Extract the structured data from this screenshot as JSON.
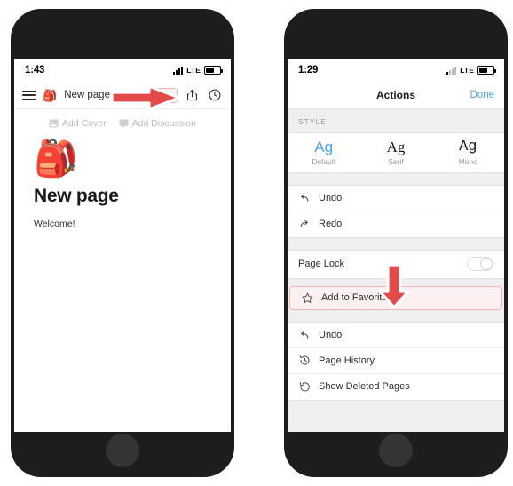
{
  "left_phone": {
    "status_bar": {
      "time": "1:43",
      "network_label": "LTE",
      "signal_icon": "signal-bars-icon",
      "battery_icon": "battery-icon"
    },
    "toolbar": {
      "menu_icon": "hamburger-menu-icon",
      "page_emoji": "🎒",
      "page_name": "New page",
      "more_icon": "ellipsis-icon",
      "share_icon": "share-icon",
      "history_icon": "clock-icon"
    },
    "page": {
      "add_cover_label": "Add Cover",
      "add_cover_icon": "image-icon",
      "add_discussion_label": "Add Discussion",
      "add_discussion_icon": "comment-icon",
      "hero_emoji": "🎒",
      "title": "New page",
      "body_text": "Welcome!"
    },
    "annotation": {
      "arrow_direction": "right",
      "arrow_color": "#e34b4b",
      "points_to": "ellipsis-icon"
    }
  },
  "right_phone": {
    "status_bar": {
      "time": "1:29",
      "network_label": "LTE",
      "signal_icon": "signal-bars-icon",
      "battery_icon": "battery-icon"
    },
    "sheet": {
      "title": "Actions",
      "done_label": "Done",
      "done_color": "#4aa3df",
      "style_group_label": "STYLE",
      "style_options": [
        {
          "sample": "Ag",
          "name": "Default",
          "selected": true
        },
        {
          "sample": "Ag",
          "name": "Serif",
          "selected": false
        },
        {
          "sample": "Ag",
          "name": "Mono",
          "selected": false
        }
      ],
      "actions_group_1": [
        {
          "label": "Undo",
          "icon": "undo-arrow-icon"
        },
        {
          "label": "Redo",
          "icon": "redo-arrow-icon"
        }
      ],
      "page_lock": {
        "label": "Page Lock",
        "toggle_state": "off"
      },
      "favorite_row": {
        "label": "Add to Favorites",
        "icon": "star-outline-icon",
        "highlighted": true,
        "highlight_border": "#f0b4b4",
        "highlight_background": "#fdf0f0"
      },
      "actions_group_2": [
        {
          "label": "Undo",
          "icon": "undo-arrow-icon"
        },
        {
          "label": "Page History",
          "icon": "clock-rewind-icon"
        },
        {
          "label": "Show Deleted Pages",
          "icon": "refresh-circle-icon"
        }
      ]
    },
    "annotation": {
      "arrow_direction": "down",
      "arrow_color": "#e34b4b",
      "points_to": "Add to Favorites"
    }
  }
}
